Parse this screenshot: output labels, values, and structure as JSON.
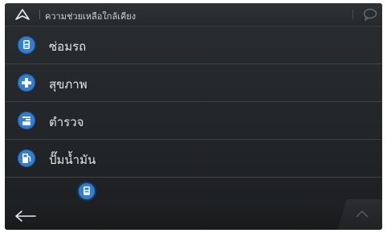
{
  "header": {
    "title": "ความช่วยเหลือใกล้เคียง",
    "nav_icon": "navigation-arrow-icon",
    "right_icon": "speech-bubble-icon"
  },
  "menu": {
    "items": [
      {
        "label": "ซ่อมรถ",
        "icon": "car-repair-icon"
      },
      {
        "label": "สุขภาพ",
        "icon": "medical-cross-icon"
      },
      {
        "label": "ตำรวจ",
        "icon": "police-icon"
      },
      {
        "label": "ปั๊มน้ำมัน",
        "icon": "fuel-pump-icon"
      }
    ]
  },
  "map_marker": {
    "icon": "car-repair-pin-icon"
  },
  "footer": {
    "back_icon": "back-arrow-icon",
    "up_icon": "chevron-up-icon"
  },
  "colors": {
    "accent": "#2f7fd6",
    "background": "#232628",
    "text": "#e4e7ea"
  }
}
